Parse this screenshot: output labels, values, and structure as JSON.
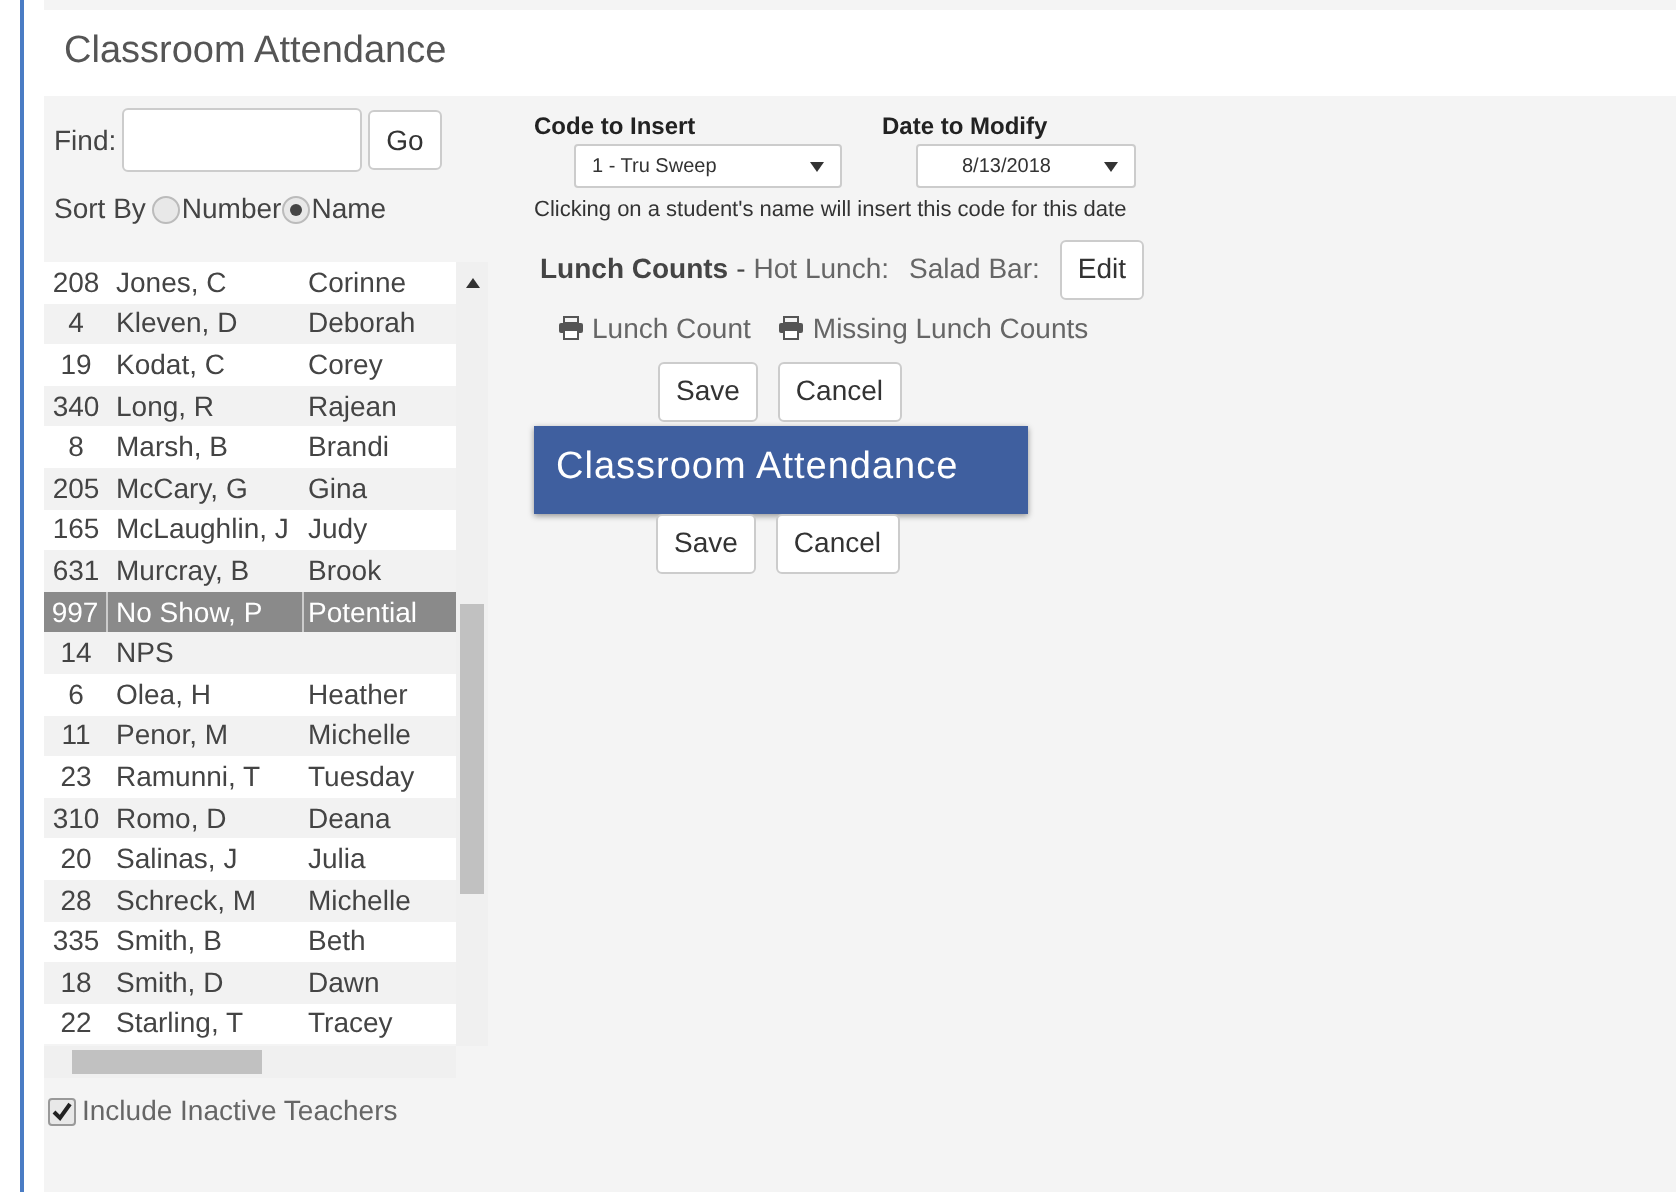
{
  "title": "Classroom Attendance",
  "find": {
    "label": "Find:",
    "button": "Go"
  },
  "sort": {
    "label": "Sort By",
    "options": [
      {
        "label": "Number",
        "selected": false
      },
      {
        "label": "Name",
        "selected": true
      }
    ]
  },
  "students": [
    {
      "number": "208",
      "name": "Jones, C",
      "first": "Corinne",
      "selected": false
    },
    {
      "number": "4",
      "name": "Kleven, D",
      "first": "Deborah",
      "selected": false
    },
    {
      "number": "19",
      "name": "Kodat, C",
      "first": "Corey",
      "selected": false
    },
    {
      "number": "340",
      "name": "Long, R",
      "first": "Rajean",
      "selected": false
    },
    {
      "number": "8",
      "name": "Marsh, B",
      "first": "Brandi",
      "selected": false
    },
    {
      "number": "205",
      "name": "McCary, G",
      "first": "Gina",
      "selected": false
    },
    {
      "number": "165",
      "name": "McLaughlin, J",
      "first": "Judy",
      "selected": false
    },
    {
      "number": "631",
      "name": "Murcray, B",
      "first": "Brook",
      "selected": false
    },
    {
      "number": "997",
      "name": "No Show, P",
      "first": "Potential",
      "selected": true
    },
    {
      "number": "14",
      "name": "NPS",
      "selected": false
    },
    {
      "number": "6",
      "name": "Olea, H",
      "first": "Heather",
      "selected": false
    },
    {
      "number": "11",
      "name": "Penor, M",
      "first": "Michelle",
      "selected": false
    },
    {
      "number": "23",
      "name": "Ramunni, T",
      "first": "Tuesday",
      "selected": false
    },
    {
      "number": "310",
      "name": "Romo, D",
      "first": "Deana",
      "selected": false
    },
    {
      "number": "20",
      "name": "Salinas, J",
      "first": "Julia",
      "selected": false
    },
    {
      "number": "28",
      "name": "Schreck, M",
      "first": "Michelle",
      "selected": false
    },
    {
      "number": "335",
      "name": "Smith, B",
      "first": "Beth",
      "selected": false
    },
    {
      "number": "18",
      "name": "Smith, D",
      "first": "Dawn",
      "selected": false
    },
    {
      "number": "22",
      "name": "Starling, T",
      "first": "Tracey",
      "selected": false
    }
  ],
  "include_inactive": {
    "label": "Include Inactive Teachers",
    "checked": true
  },
  "code": {
    "label": "Code to Insert",
    "value": "1 - Tru Sweep"
  },
  "date": {
    "label": "Date to Modify",
    "value": "8/13/2018"
  },
  "note": "Clicking on a student's name will insert this code for this date",
  "lunch": {
    "label": "Lunch Counts",
    "separator": "-",
    "hot": "Hot Lunch:",
    "salad": "Salad Bar:",
    "edit": "Edit"
  },
  "print_links": [
    "Lunch Count",
    "Missing Lunch Counts"
  ],
  "top_buttons": [
    "Save",
    "Cancel"
  ],
  "banner": "Classroom Attendance",
  "bottom_buttons": [
    "Save",
    "Cancel"
  ]
}
